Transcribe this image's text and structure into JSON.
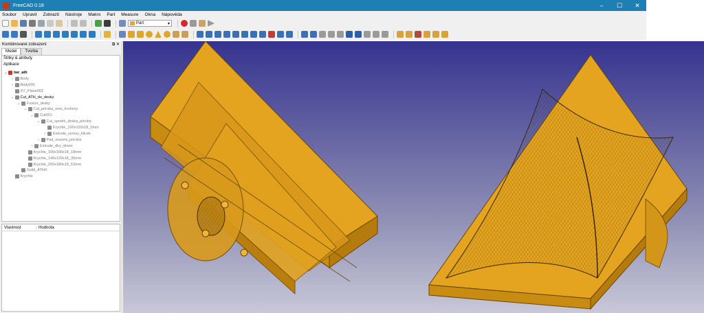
{
  "window": {
    "title": "FreeCAD 0.18",
    "controls": [
      "–",
      "☐",
      "✕"
    ]
  },
  "menu": [
    "Soubor",
    "Upravit",
    "Zobrazit",
    "Nástroje",
    "Makro",
    "Part",
    "Measure",
    "Okna",
    "Nápověda"
  ],
  "workbench_combo": {
    "value": "Part"
  },
  "combo_panel": {
    "title": "Kombinované zobrazení",
    "tabs": [
      "Model",
      "Tvorba"
    ]
  },
  "tree": {
    "header": "Štítky & atributy",
    "root_label": "Aplikace",
    "items": [
      {
        "label": "twr_ath",
        "depth": 0,
        "expand": "v",
        "style": "bold"
      },
      {
        "label": "Body",
        "depth": 1,
        "expand": ">",
        "style": "dim"
      },
      {
        "label": "Body001",
        "depth": 1,
        "expand": ">",
        "style": "dim"
      },
      {
        "label": "XY_Plane002",
        "depth": 1,
        "expand": "",
        "style": "dim"
      },
      {
        "label": "Cut_ATH_do_desky",
        "depth": 1,
        "expand": "v",
        "style": "normal"
      },
      {
        "label": "Fusion_desky",
        "depth": 2,
        "expand": "v",
        "style": "dim"
      },
      {
        "label": "Cut_priruba_orez_kruhovy",
        "depth": 3,
        "expand": "v",
        "style": "dim"
      },
      {
        "label": "Cut001",
        "depth": 4,
        "expand": "v",
        "style": "dim"
      },
      {
        "label": "Cut_spodni_deska_priruby",
        "depth": 5,
        "expand": "v",
        "style": "dim"
      },
      {
        "label": "Krychle_100x100x18_0mm",
        "depth": 6,
        "expand": "",
        "style": "dim"
      },
      {
        "label": "Extrude_vyrezy_klicek",
        "depth": 6,
        "expand": ">",
        "style": "dim"
      },
      {
        "label": "Pad_srazeni_priruba",
        "depth": 5,
        "expand": ">",
        "style": "dim"
      },
      {
        "label": "Extrude_diry_driver",
        "depth": 4,
        "expand": ">",
        "style": "dim"
      },
      {
        "label": "Krychle_100x100x18_18mm",
        "depth": 3,
        "expand": "",
        "style": "dim"
      },
      {
        "label": "Krychle_140x120x18_35mm",
        "depth": 3,
        "expand": "",
        "style": "dim"
      },
      {
        "label": "Krychle_200x180x18_53mm",
        "depth": 3,
        "expand": "",
        "style": "dim"
      },
      {
        "label": "Solid_ATH0",
        "depth": 2,
        "expand": "",
        "style": "dim"
      },
      {
        "label": "Krychle",
        "depth": 1,
        "expand": "",
        "style": "dim"
      }
    ]
  },
  "properties": {
    "col_property": "Vlastnost",
    "col_value": "Hodnota"
  },
  "colors": {
    "titlebar": "#1e7fb5",
    "part_fill": "#e0a21f",
    "part_edge": "#5a3d00",
    "record_button": "#d62828"
  }
}
